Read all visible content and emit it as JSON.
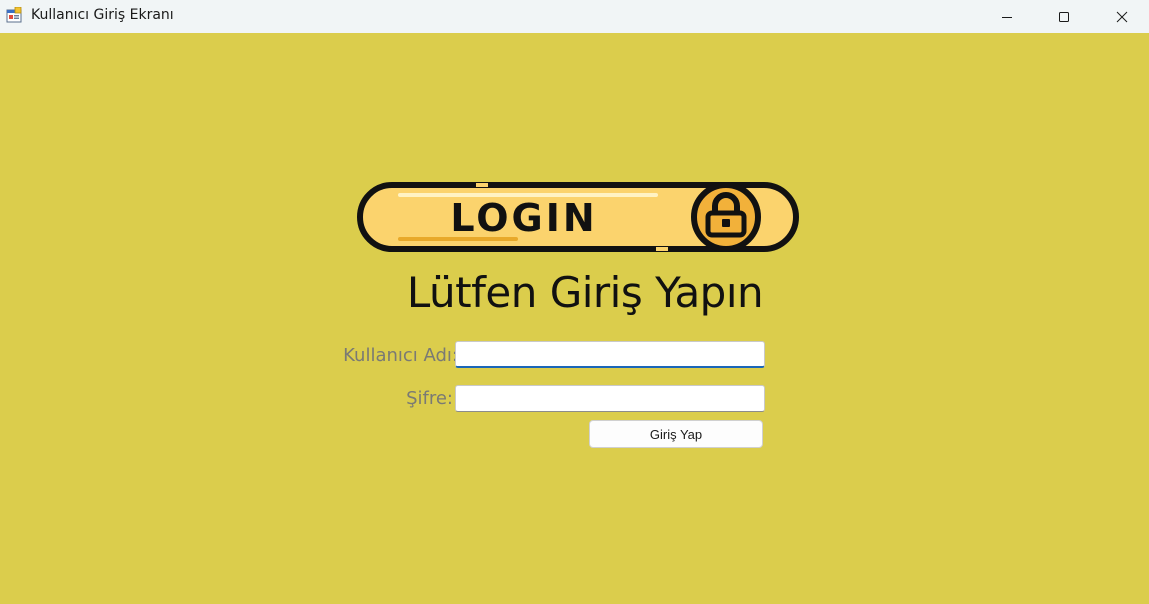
{
  "window": {
    "title": "Kullanıcı Giriş Ekranı",
    "icon": "app-form-icon",
    "controls": {
      "minimize_icon": "minimize-icon",
      "maximize_icon": "maximize-icon",
      "close_icon": "close-icon"
    }
  },
  "colors": {
    "background": "#dbcd4c",
    "titlebar": "#f1f5f6",
    "logo_accent": "#f2b13a",
    "logo_fill": "#fbd36d"
  },
  "logo": {
    "text": "LOGIN",
    "icon": "padlock-icon"
  },
  "form": {
    "heading": "Lütfen Giriş Yapın",
    "username_label": "Kullanıcı Adı:",
    "username_value": "",
    "password_label": "Şifre:",
    "password_value": "",
    "submit_label": "Giriş Yap"
  }
}
